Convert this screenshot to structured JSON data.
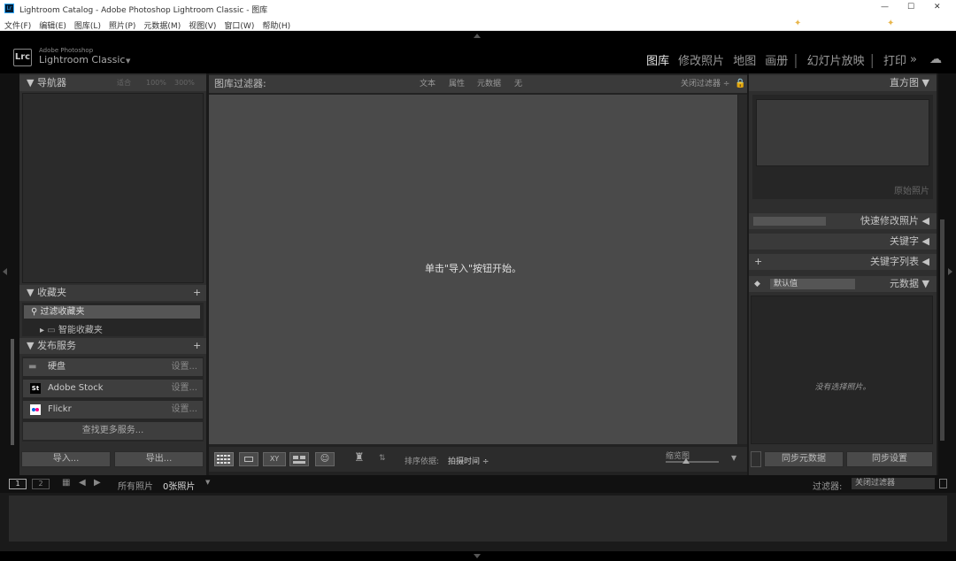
{
  "window": {
    "title": "Lightroom Catalog - Adobe Photoshop Lightroom Classic - 图库",
    "controls": [
      "—",
      "☐",
      "✕"
    ]
  },
  "menu": [
    "文件(F)",
    "编辑(E)",
    "图库(L)",
    "照片(P)",
    "元数据(M)",
    "视图(V)",
    "窗口(W)",
    "帮助(H)"
  ],
  "identity": {
    "logo": "Lrc",
    "brand_small": "Adobe Photoshop",
    "brand": "Lightroom Classic",
    "arrow": "▼"
  },
  "modules": [
    "图库",
    "修改照片",
    "地图",
    "画册",
    "幻灯片放映",
    "打印"
  ],
  "modules_more": "»",
  "navigator": {
    "title": "导航器",
    "zoom": [
      "适合",
      "100%",
      "300%"
    ]
  },
  "collections": {
    "title": "收藏夹",
    "add": "+",
    "items": [
      "过滤收藏夹",
      "智能收藏夹"
    ]
  },
  "publish": {
    "title": "发布服务",
    "add": "+",
    "items": [
      {
        "name": "硬盘",
        "action": "设置..."
      },
      {
        "name": "Adobe Stock",
        "action": "设置..."
      },
      {
        "name": "Flickr",
        "action": "设置..."
      }
    ],
    "find_more": "查找更多服务..."
  },
  "left_buttons": {
    "import": "导入...",
    "export": "导出..."
  },
  "filter": {
    "title": "图库过滤器:",
    "tabs": [
      "文本",
      "属性",
      "元数据",
      "无"
    ],
    "preset": "关闭过滤器 ÷"
  },
  "center": {
    "message": "单击\"导入\"按钮开始。"
  },
  "toolbar": {
    "sort_label": "排序依据:",
    "sort_value": "拍摄时间 ÷",
    "thumb_label": "缩览图"
  },
  "right": {
    "histogram": "直方图",
    "quick_develop": "快速修改照片",
    "preset_dropdown": "",
    "keywords": "关键字",
    "keyword_list": "关键字列表",
    "metadata": "元数据",
    "metadata_preset": "默认值",
    "no_photo": "没有选择照片。",
    "original": "原始照片",
    "sync_metadata": "同步元数据",
    "sync_settings": "同步设置"
  },
  "filmstrip": {
    "pages": [
      "1",
      "2"
    ],
    "source_label": "所有照片",
    "count": "0张照片",
    "filter_label": "过滤器:",
    "filter_value": "关闭过滤器"
  }
}
